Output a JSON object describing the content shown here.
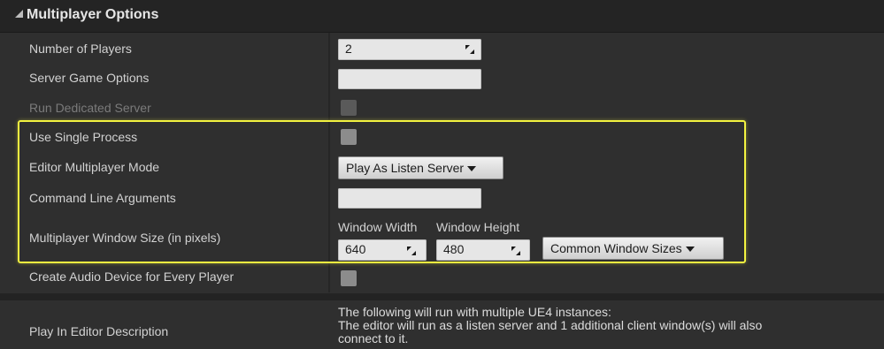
{
  "section": {
    "title": "Multiplayer Options"
  },
  "rows": {
    "num_players": {
      "label": "Number of Players",
      "value": "2"
    },
    "server_game_options": {
      "label": "Server Game Options",
      "value": ""
    },
    "run_dedicated_server": {
      "label": "Run Dedicated Server",
      "checked": false
    },
    "use_single_process": {
      "label": "Use Single Process",
      "checked": false
    },
    "editor_multiplayer_mode": {
      "label": "Editor Multiplayer Mode",
      "value": "Play As Listen Server"
    },
    "command_line_arguments": {
      "label": "Command Line Arguments",
      "value": ""
    },
    "window_size": {
      "label": "Multiplayer Window Size (in pixels)",
      "width_label": "Window Width",
      "height_label": "Window Height",
      "width_value": "640",
      "height_value": "480",
      "common_sizes_label": "Common Window Sizes"
    },
    "audio_device": {
      "label": "Create Audio Device for Every Player",
      "checked": false
    }
  },
  "description": {
    "label": "Play In Editor Description",
    "line1": "The following will run with multiple UE4 instances:",
    "line2": "The editor will run as a listen server and 1 additional client window(s) will also",
    "line3": "connect to it."
  },
  "colors": {
    "panel_bg": "#2f2f2f",
    "header_bg": "#242424",
    "highlight": "#f2f240",
    "field_bg": "#e6e6e6"
  }
}
